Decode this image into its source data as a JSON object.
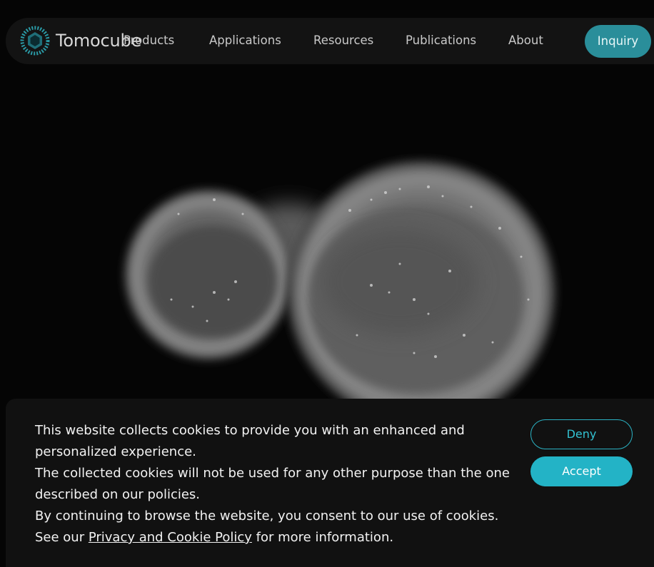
{
  "brand": {
    "name": "Tomocube",
    "accent_color": "#2a8e9a"
  },
  "nav": {
    "items": [
      {
        "label": "Products"
      },
      {
        "label": "Applications"
      },
      {
        "label": "Resources"
      },
      {
        "label": "Publications"
      },
      {
        "label": "About"
      }
    ],
    "inquiry_label": "Inquiry"
  },
  "hero": {
    "image": "cell-micrograph"
  },
  "cookie_banner": {
    "line1": "This website collects cookies to provide you with an enhanced and personalized experience.",
    "line2": "The collected cookies will not be used for any other purpose than the one described on our policies.",
    "line3": "By continuing to browse the website, you consent to our use of cookies.",
    "line4_prefix": "See our ",
    "policy_link": "Privacy and Cookie Policy",
    "line4_suffix": " for more information.",
    "deny_label": "Deny",
    "accept_label": "Accept",
    "button_color": "#23b3c6"
  }
}
